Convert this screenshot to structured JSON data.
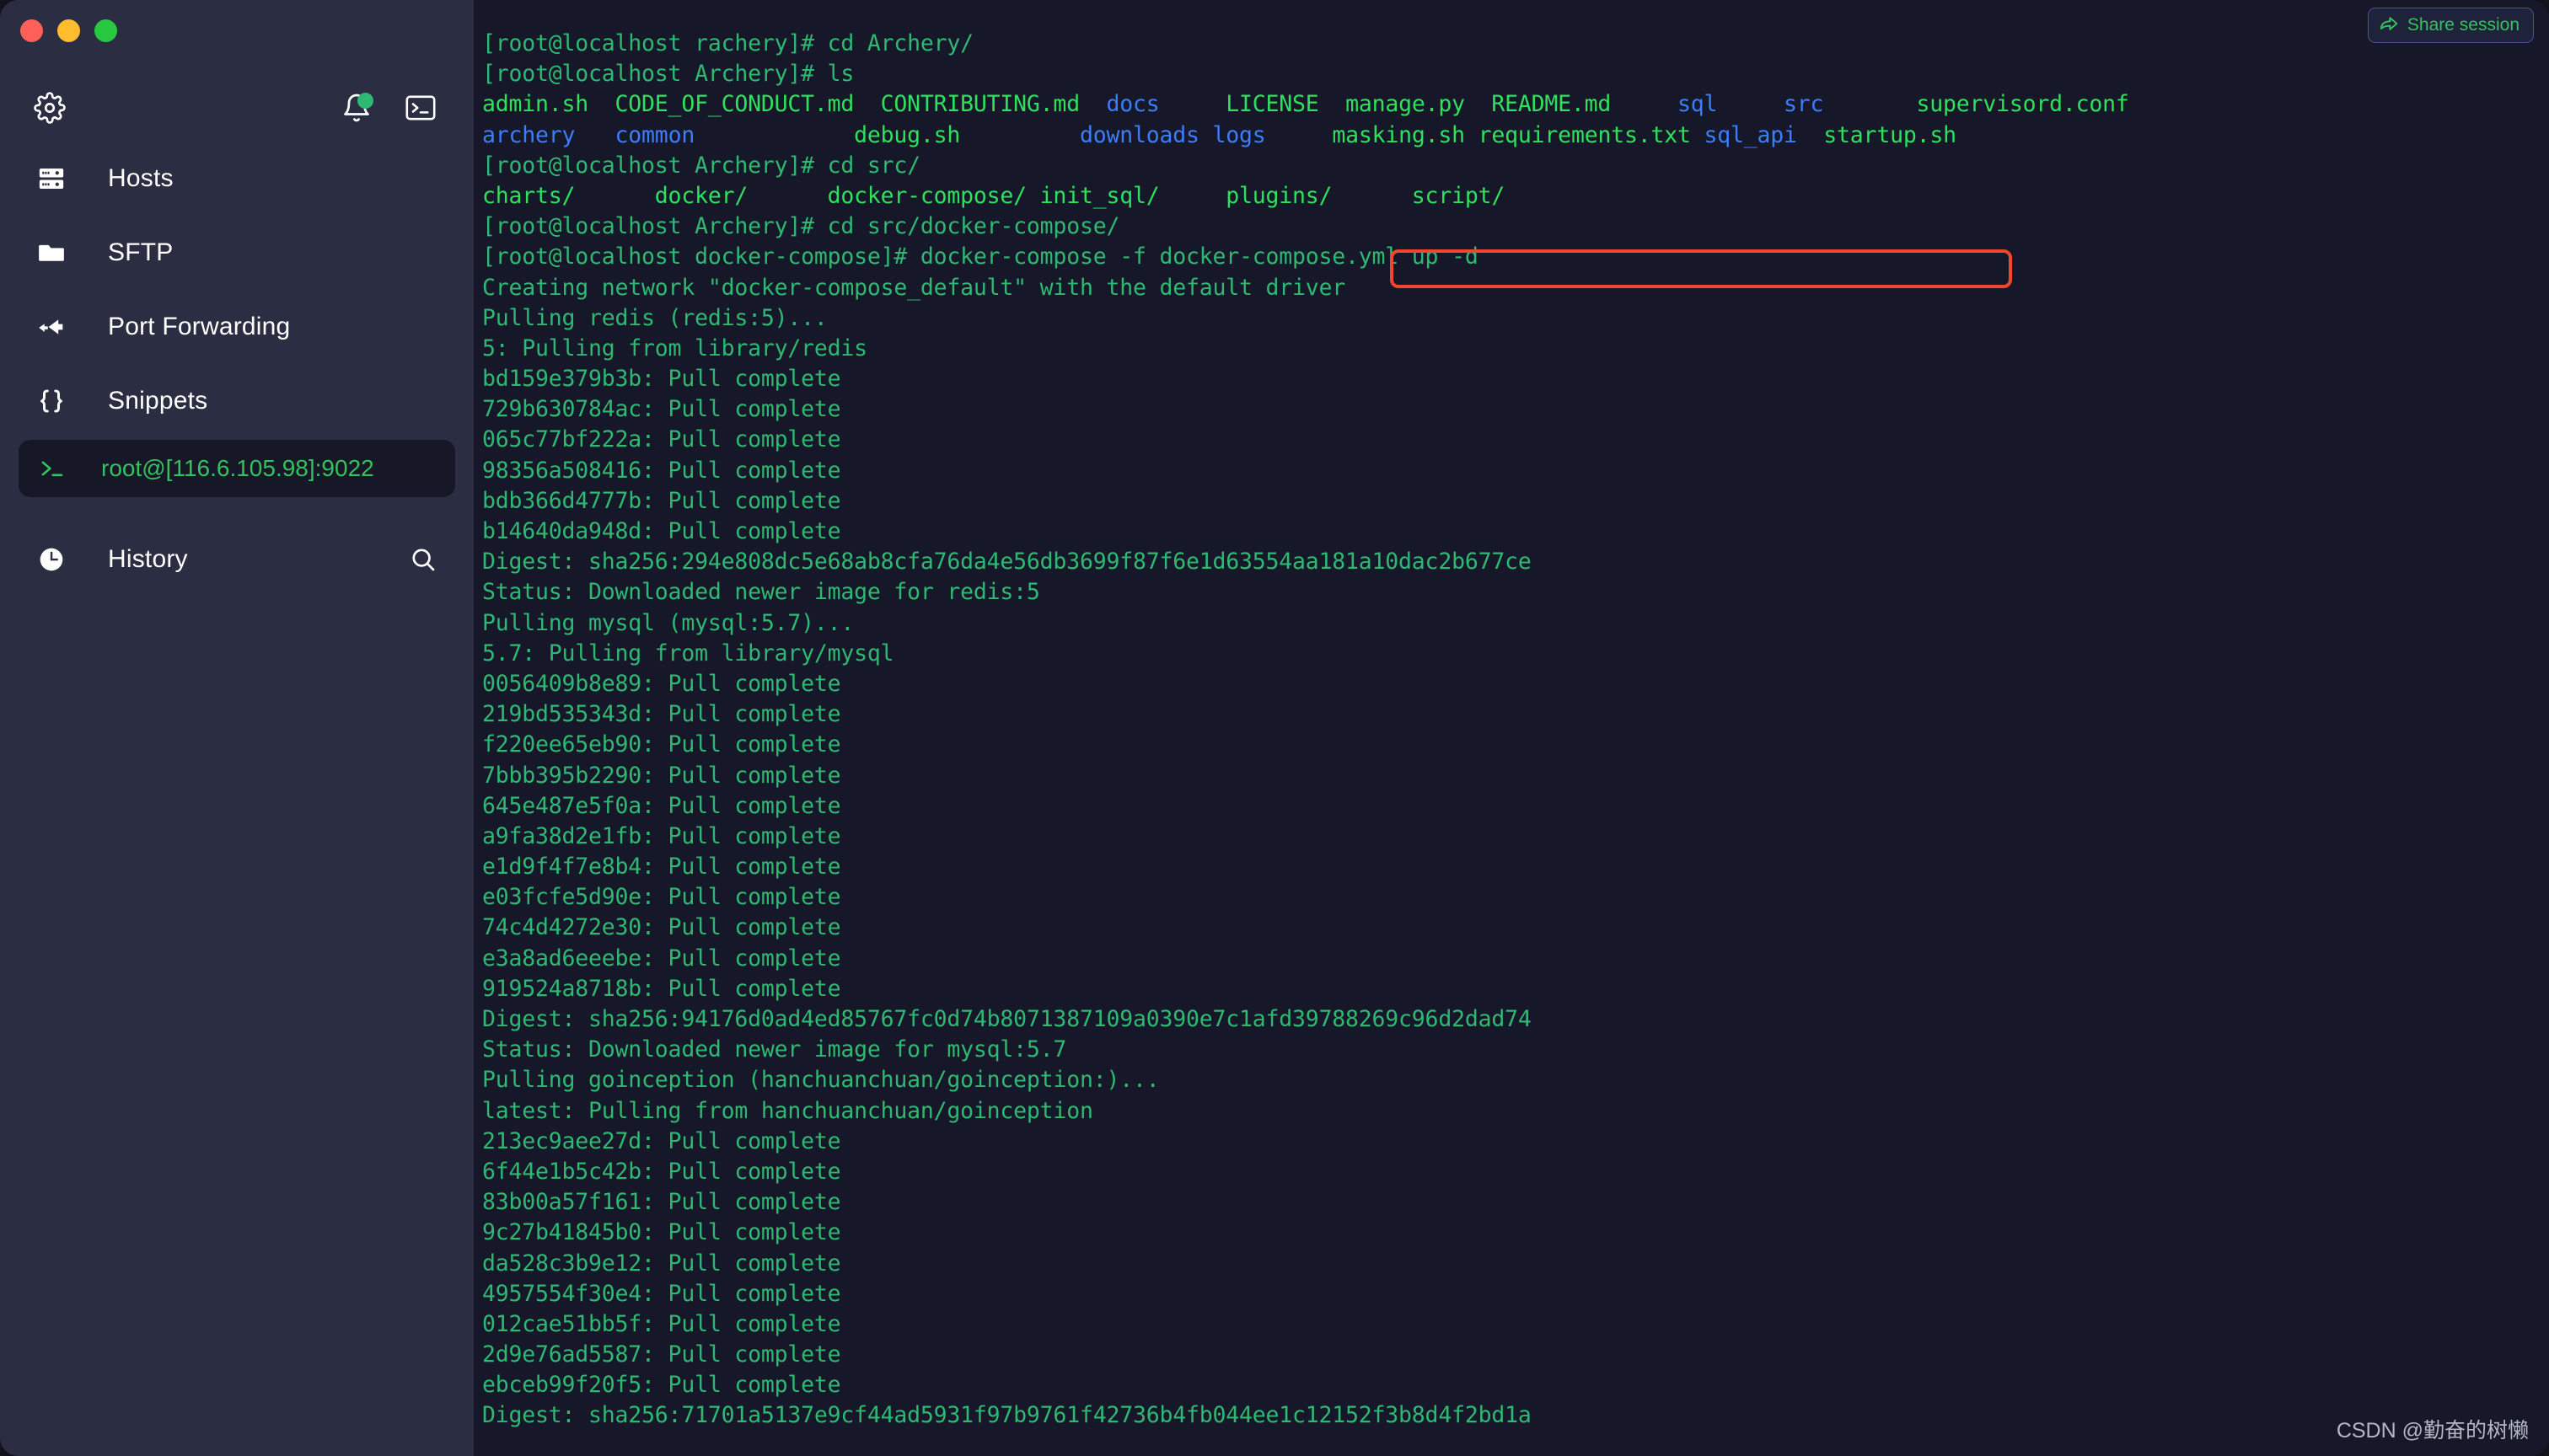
{
  "window": {
    "traffic_lights": [
      "close",
      "minimize",
      "maximize"
    ],
    "colors": {
      "sidebar_bg": "#2b2d42",
      "terminal_bg": "#161829",
      "accent_green": "#2eb872",
      "highlight_red": "#f2452f",
      "dir_blue": "#3b7dfa"
    }
  },
  "sidebar": {
    "toolbar": {
      "settings_icon": "gear-icon",
      "notifications_icon": "bell-icon",
      "notifications_badge": true,
      "terminal_icon": "terminal-icon"
    },
    "items": [
      {
        "label": "Hosts",
        "icon": "server-icon"
      },
      {
        "label": "SFTP",
        "icon": "folder-icon"
      },
      {
        "label": "Port Forwarding",
        "icon": "arrow-forward-icon"
      },
      {
        "label": "Snippets",
        "icon": "braces-icon"
      }
    ],
    "session": {
      "label": "root@[116.6.105.98]:9022",
      "icon": "prompt-icon",
      "active": true
    },
    "history": {
      "label": "History",
      "icon": "clock-icon",
      "search_icon": "search-icon"
    }
  },
  "header": {
    "share_session_label": "Share session",
    "share_session_icon": "share-arrow-icon"
  },
  "terminal": {
    "highlighted_command": "docker-compose -f docker-compose.yml up -d",
    "lines": [
      [
        {
          "t": "[root@localhost rachery]# cd Archery/",
          "c": "g"
        }
      ],
      [
        {
          "t": "[root@localhost Archery]# ls",
          "c": "g"
        }
      ],
      [
        {
          "t": "admin.sh  CODE_OF_CONDUCT.md  CONTRIBUTING.md  ",
          "c": "bg"
        },
        {
          "t": "docs",
          "c": "bl"
        },
        {
          "t": "     LICENSE  ",
          "c": "bg"
        },
        {
          "t": "manage.py",
          "c": "bg"
        },
        {
          "t": "  README.md",
          "c": "bg"
        },
        {
          "t": "     ",
          "c": "g"
        },
        {
          "t": "sql",
          "c": "bl"
        },
        {
          "t": "     ",
          "c": "g"
        },
        {
          "t": "src",
          "c": "bl"
        },
        {
          "t": "       supervisord.conf",
          "c": "bg"
        }
      ],
      [
        {
          "t": "archery",
          "c": "bl"
        },
        {
          "t": "   ",
          "c": "g"
        },
        {
          "t": "common",
          "c": "bl"
        },
        {
          "t": "            ",
          "c": "g"
        },
        {
          "t": "debug.sh",
          "c": "bg"
        },
        {
          "t": "         ",
          "c": "g"
        },
        {
          "t": "downloads",
          "c": "bl"
        },
        {
          "t": " ",
          "c": "g"
        },
        {
          "t": "logs",
          "c": "bl"
        },
        {
          "t": "     ",
          "c": "g"
        },
        {
          "t": "masking.sh",
          "c": "bg"
        },
        {
          "t": " requirements.txt ",
          "c": "bg"
        },
        {
          "t": "sql_api",
          "c": "bl"
        },
        {
          "t": "  ",
          "c": "g"
        },
        {
          "t": "startup.sh",
          "c": "bg"
        }
      ],
      [
        {
          "t": "[root@localhost Archery]# cd src/",
          "c": "g"
        }
      ],
      [
        {
          "t": "charts/      docker/      docker-compose/ init_sql/     plugins/      script/",
          "c": "bg"
        }
      ],
      [
        {
          "t": "[root@localhost Archery]# cd src/docker-compose/",
          "c": "g"
        }
      ],
      [
        {
          "t": "[root@localhost docker-compose]# docker-compose -f docker-compose.yml up -d",
          "c": "g"
        }
      ],
      [
        {
          "t": "Creating network \"docker-compose_default\" with the default driver",
          "c": "g"
        }
      ],
      [
        {
          "t": "Pulling redis (redis:5)...",
          "c": "g"
        }
      ],
      [
        {
          "t": "5: Pulling from library/redis",
          "c": "g"
        }
      ],
      [
        {
          "t": "bd159e379b3b: Pull complete",
          "c": "g"
        }
      ],
      [
        {
          "t": "729b630784ac: Pull complete",
          "c": "g"
        }
      ],
      [
        {
          "t": "065c77bf222a: Pull complete",
          "c": "g"
        }
      ],
      [
        {
          "t": "98356a508416: Pull complete",
          "c": "g"
        }
      ],
      [
        {
          "t": "bdb366d4777b: Pull complete",
          "c": "g"
        }
      ],
      [
        {
          "t": "b14640da948d: Pull complete",
          "c": "g"
        }
      ],
      [
        {
          "t": "Digest: sha256:294e808dc5e68ab8cfa76da4e56db3699f87f6e1d63554aa181a10dac2b677ce",
          "c": "g"
        }
      ],
      [
        {
          "t": "Status: Downloaded newer image for redis:5",
          "c": "g"
        }
      ],
      [
        {
          "t": "Pulling mysql (mysql:5.7)...",
          "c": "g"
        }
      ],
      [
        {
          "t": "5.7: Pulling from library/mysql",
          "c": "g"
        }
      ],
      [
        {
          "t": "0056409b8e89: Pull complete",
          "c": "g"
        }
      ],
      [
        {
          "t": "219bd535343d: Pull complete",
          "c": "g"
        }
      ],
      [
        {
          "t": "f220ee65eb90: Pull complete",
          "c": "g"
        }
      ],
      [
        {
          "t": "7bbb395b2290: Pull complete",
          "c": "g"
        }
      ],
      [
        {
          "t": "645e487e5f0a: Pull complete",
          "c": "g"
        }
      ],
      [
        {
          "t": "a9fa38d2e1fb: Pull complete",
          "c": "g"
        }
      ],
      [
        {
          "t": "e1d9f4f7e8b4: Pull complete",
          "c": "g"
        }
      ],
      [
        {
          "t": "e03fcfe5d90e: Pull complete",
          "c": "g"
        }
      ],
      [
        {
          "t": "74c4d4272e30: Pull complete",
          "c": "g"
        }
      ],
      [
        {
          "t": "e3a8ad6eeebe: Pull complete",
          "c": "g"
        }
      ],
      [
        {
          "t": "919524a8718b: Pull complete",
          "c": "g"
        }
      ],
      [
        {
          "t": "Digest: sha256:94176d0ad4ed85767fc0d74b8071387109a0390e7c1afd39788269c96d2dad74",
          "c": "g"
        }
      ],
      [
        {
          "t": "Status: Downloaded newer image for mysql:5.7",
          "c": "g"
        }
      ],
      [
        {
          "t": "Pulling goinception (hanchuanchuan/goinception:)...",
          "c": "g"
        }
      ],
      [
        {
          "t": "latest: Pulling from hanchuanchuan/goinception",
          "c": "g"
        }
      ],
      [
        {
          "t": "213ec9aee27d: Pull complete",
          "c": "g"
        }
      ],
      [
        {
          "t": "6f44e1b5c42b: Pull complete",
          "c": "g"
        }
      ],
      [
        {
          "t": "83b00a57f161: Pull complete",
          "c": "g"
        }
      ],
      [
        {
          "t": "9c27b41845b0: Pull complete",
          "c": "g"
        }
      ],
      [
        {
          "t": "da528c3b9e12: Pull complete",
          "c": "g"
        }
      ],
      [
        {
          "t": "4957554f30e4: Pull complete",
          "c": "g"
        }
      ],
      [
        {
          "t": "012cae51bb5f: Pull complete",
          "c": "g"
        }
      ],
      [
        {
          "t": "2d9e76ad5587: Pull complete",
          "c": "g"
        }
      ],
      [
        {
          "t": "ebceb99f20f5: Pull complete",
          "c": "g"
        }
      ],
      [
        {
          "t": "Digest: sha256:71701a5137e9cf44ad5931f97b9761f42736b4fb044ee1c12152f3b8d4f2bd1a",
          "c": "g"
        }
      ]
    ]
  },
  "watermark": {
    "text": "CSDN @勤奋的树懒"
  }
}
